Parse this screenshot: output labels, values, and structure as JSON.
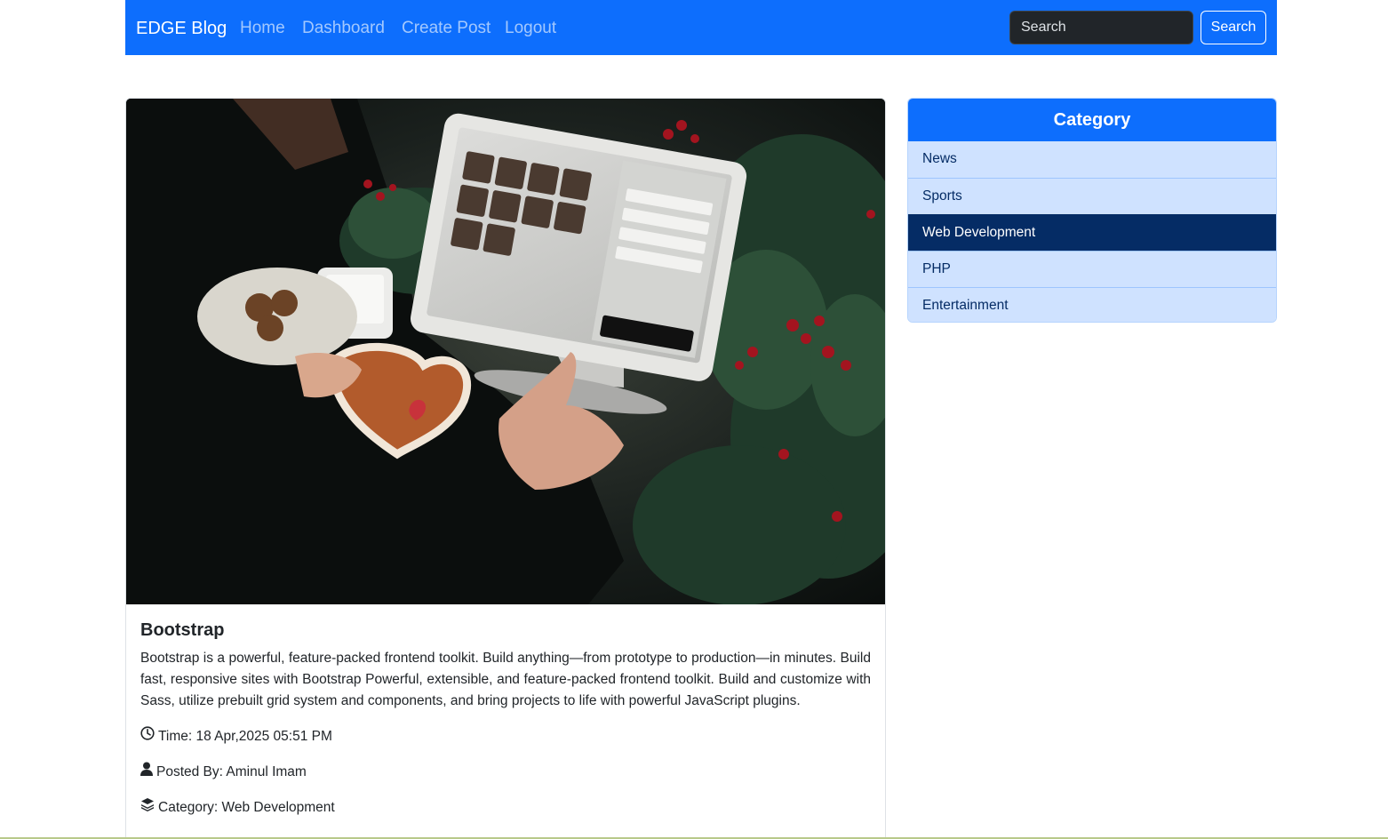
{
  "navbar": {
    "brand": "EDGE Blog",
    "links": [
      "Home",
      "Dashboard",
      "Create Post",
      "Logout"
    ],
    "search_placeholder": "Search",
    "search_button": "Search"
  },
  "post": {
    "title": "Bootstrap",
    "body": "Bootstrap is a powerful, feature-packed frontend toolkit. Build anything—from prototype to production—in minutes. Build fast, responsive sites with Bootstrap Powerful, extensible, and feature-packed frontend toolkit. Build and customize with Sass, utilize prebuilt grid system and components, and bring projects to life with powerful JavaScript plugins.",
    "time": "Time: 18 Apr,2025 05:51 PM",
    "author": "Posted By: Aminul Imam",
    "category": "Category: Web Development",
    "image_alt": "Photo of a hand tapping a point-of-sale tablet beside a gingerbread heart and holly"
  },
  "sidebar": {
    "heading": "Category",
    "items": [
      {
        "label": "News",
        "active": false
      },
      {
        "label": "Sports",
        "active": false
      },
      {
        "label": "Web Development",
        "active": true
      },
      {
        "label": "PHP",
        "active": false
      },
      {
        "label": "Entertainment",
        "active": false
      }
    ]
  },
  "icons": {
    "time": "clock-icon",
    "author": "user-icon",
    "category": "layer-group-icon"
  },
  "colors": {
    "primary": "#0d6efd",
    "list_bg": "#cfe2ff",
    "list_active": "#052c65",
    "search_bg": "#212529"
  }
}
